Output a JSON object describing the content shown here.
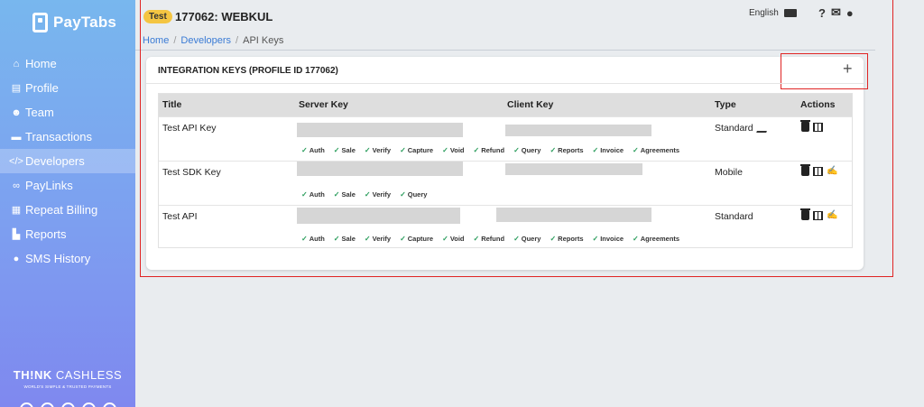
{
  "brand": {
    "name": "PayTabs"
  },
  "sidebar": {
    "items": [
      {
        "label": "Home",
        "icon": "home-icon",
        "glyph": "⌂",
        "active": false
      },
      {
        "label": "Profile",
        "icon": "profile-icon",
        "glyph": "▤",
        "active": false
      },
      {
        "label": "Team",
        "icon": "team-icon",
        "glyph": "☻",
        "active": false
      },
      {
        "label": "Transactions",
        "icon": "transactions-icon",
        "glyph": "▬",
        "active": false
      },
      {
        "label": "Developers",
        "icon": "code-icon",
        "glyph": "</>",
        "active": true
      },
      {
        "label": "PayLinks",
        "icon": "link-icon",
        "glyph": "∞",
        "active": false
      },
      {
        "label": "Repeat Billing",
        "icon": "calendar-icon",
        "glyph": "▦",
        "active": false
      },
      {
        "label": "Reports",
        "icon": "chart-icon",
        "glyph": "▙",
        "active": false
      },
      {
        "label": "SMS History",
        "icon": "chat-icon",
        "glyph": "●",
        "active": false
      }
    ],
    "tagline_bold": "TH!NK",
    "tagline_rest": " CASHLESS",
    "tagline_sub": "WORLD'S SIMPLE & TRUSTED PAYMENTS"
  },
  "header": {
    "badge": "Test",
    "title": "177062: WEBKUL",
    "language": "English",
    "help_glyph": "?",
    "mail_glyph": "✉",
    "user_glyph": "●"
  },
  "breadcrumb": {
    "home": "Home",
    "developers": "Developers",
    "current": "API Keys"
  },
  "card": {
    "title": "INTEGRATION KEYS (PROFILE ID 177062)",
    "add_glyph": "+"
  },
  "table": {
    "headers": [
      "Title",
      "Server Key",
      "Client Key",
      "Type",
      "Actions"
    ],
    "rows": [
      {
        "title": "Test API Key",
        "type": "Standard",
        "permissions": [
          "Auth",
          "Sale",
          "Verify",
          "Capture",
          "Void",
          "Refund",
          "Query",
          "Reports",
          "Invoice",
          "Agreements"
        ]
      },
      {
        "title": "Test SDK Key",
        "type": "Mobile",
        "permissions": [
          "Auth",
          "Sale",
          "Verify",
          "Query"
        ]
      },
      {
        "title": "Test API",
        "type": "Standard",
        "permissions": [
          "Auth",
          "Sale",
          "Verify",
          "Capture",
          "Void",
          "Refund",
          "Query",
          "Reports",
          "Invoice",
          "Agreements"
        ]
      }
    ]
  },
  "colors": {
    "accent": "#3a7bd5",
    "badge": "#f4c542",
    "highlight": "#e02424",
    "check": "#2a9d5c"
  }
}
